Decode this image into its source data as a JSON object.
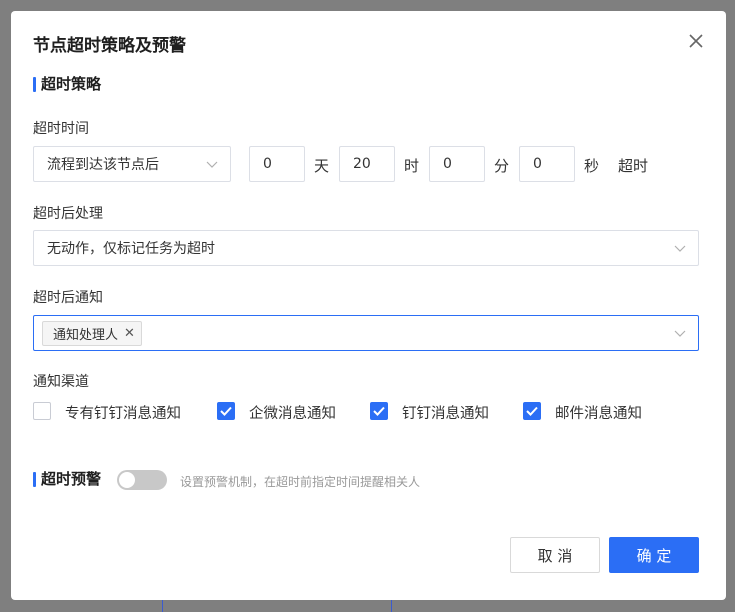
{
  "dialog": {
    "title": "节点超时策略及预警"
  },
  "strategy": {
    "section_title": "超时策略",
    "timeout_time": {
      "label": "超时时间",
      "base_select": "流程到达该节点后",
      "days_value": "0",
      "days_unit": "天",
      "hours_value": "20",
      "hours_unit": "时",
      "minutes_value": "0",
      "minutes_unit": "分",
      "seconds_value": "0",
      "seconds_unit": "秒",
      "suffix": "超时"
    },
    "after_timeout_action": {
      "label": "超时后处理",
      "selected": "无动作，仅标记任务为超时"
    },
    "after_timeout_notify": {
      "label": "超时后通知",
      "tags": [
        "通知处理人"
      ]
    },
    "channels": {
      "label": "通知渠道",
      "items": [
        {
          "label": "专有钉钉消息通知",
          "checked": false
        },
        {
          "label": "企微消息通知",
          "checked": true
        },
        {
          "label": "钉钉消息通知",
          "checked": true
        },
        {
          "label": "邮件消息通知",
          "checked": true
        }
      ]
    }
  },
  "warning": {
    "section_title": "超时预警",
    "enabled": false,
    "hint": "设置预警机制，在超时前指定时间提醒相关人"
  },
  "footer": {
    "cancel_label": "取 消",
    "ok_label": "确 定"
  },
  "colors": {
    "accent": "#2b6ef5",
    "overlay": "#7f7f7f"
  }
}
